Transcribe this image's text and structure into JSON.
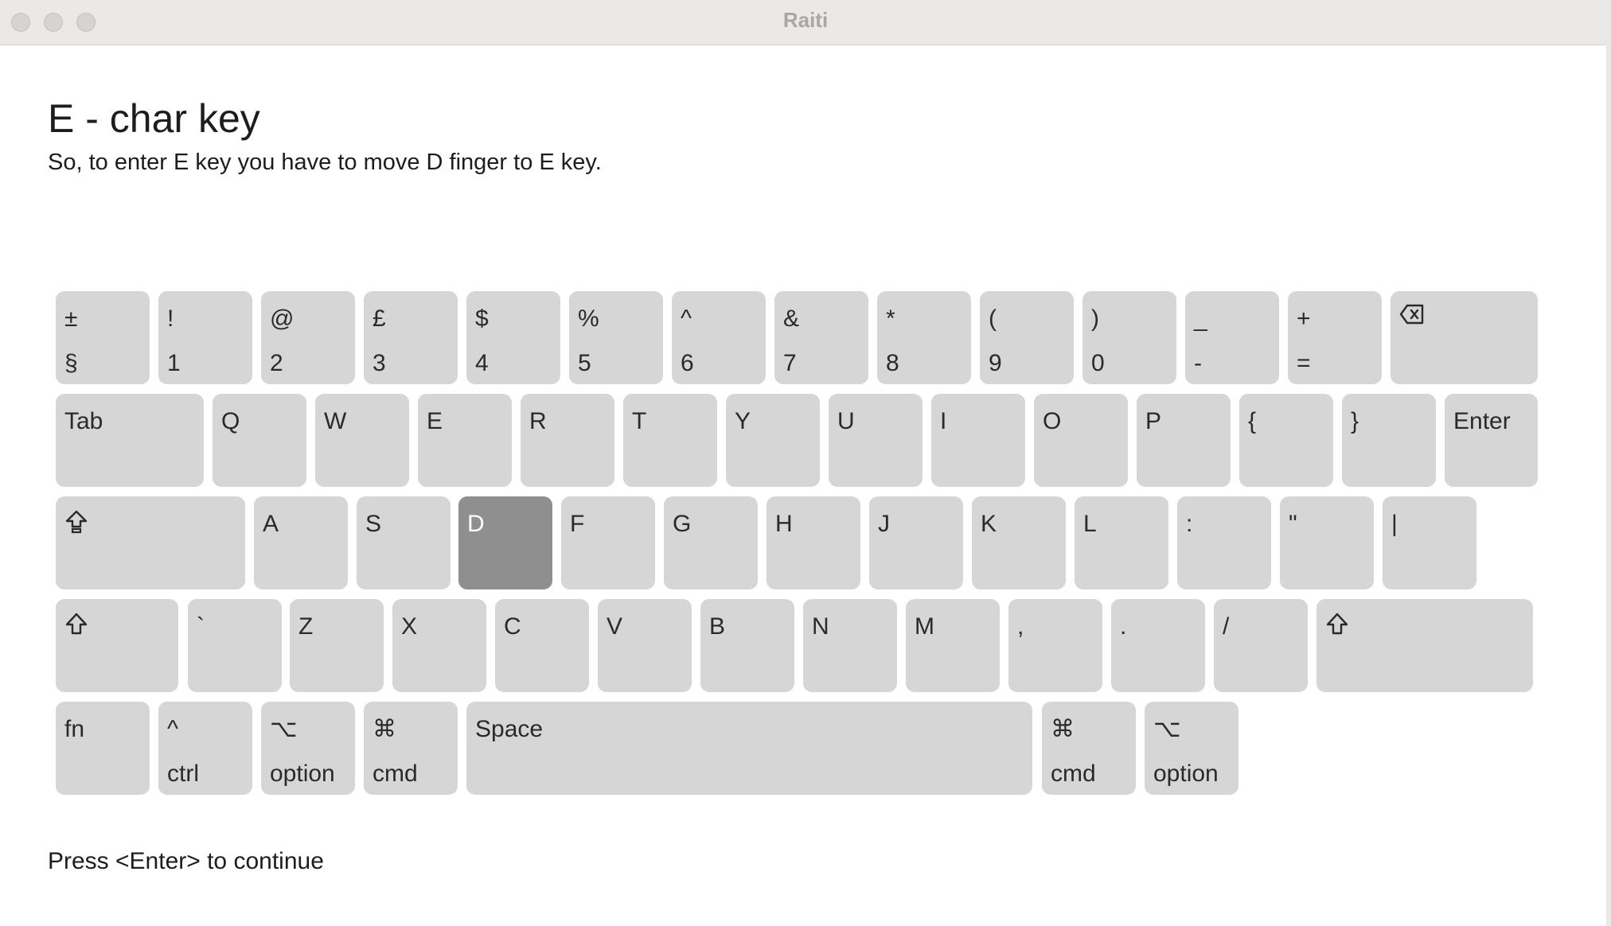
{
  "window": {
    "title": "Raiti"
  },
  "lesson": {
    "title": "E - char key",
    "subtitle": "So, to enter E key you have to move D finger to E key.",
    "footer": "Press <Enter> to continue"
  },
  "keyboard": {
    "highlighted_key": "D",
    "highlight_color": "#8f8f8f",
    "key_color": "#d6d6d6",
    "rows": [
      [
        {
          "top": "±",
          "bottom": "§"
        },
        {
          "top": "!",
          "bottom": "1"
        },
        {
          "top": "@",
          "bottom": "2"
        },
        {
          "top": "£",
          "bottom": "3"
        },
        {
          "top": "$",
          "bottom": "4"
        },
        {
          "top": "%",
          "bottom": "5"
        },
        {
          "top": "^",
          "bottom": "6"
        },
        {
          "top": "&",
          "bottom": "7"
        },
        {
          "top": "*",
          "bottom": "8"
        },
        {
          "top": "(",
          "bottom": "9"
        },
        {
          "top": ")",
          "bottom": "0"
        },
        {
          "top": "_",
          "bottom": "-"
        },
        {
          "top": "+",
          "bottom": "="
        },
        {
          "icon": "backspace-icon"
        }
      ],
      [
        {
          "label": "Tab"
        },
        {
          "label": "Q"
        },
        {
          "label": "W"
        },
        {
          "label": "E"
        },
        {
          "label": "R"
        },
        {
          "label": "T"
        },
        {
          "label": "Y"
        },
        {
          "label": "U"
        },
        {
          "label": "I"
        },
        {
          "label": "O"
        },
        {
          "label": "P"
        },
        {
          "label": "{"
        },
        {
          "label": "}"
        },
        {
          "label": "Enter"
        }
      ],
      [
        {
          "icon": "caps-lock-icon"
        },
        {
          "label": "A"
        },
        {
          "label": "S"
        },
        {
          "label": "D"
        },
        {
          "label": "F"
        },
        {
          "label": "G"
        },
        {
          "label": "H"
        },
        {
          "label": "J"
        },
        {
          "label": "K"
        },
        {
          "label": "L"
        },
        {
          "label": ":"
        },
        {
          "label": "\""
        },
        {
          "label": "|"
        }
      ],
      [
        {
          "icon": "shift-icon"
        },
        {
          "label": "`"
        },
        {
          "label": "Z"
        },
        {
          "label": "X"
        },
        {
          "label": "C"
        },
        {
          "label": "V"
        },
        {
          "label": "B"
        },
        {
          "label": "N"
        },
        {
          "label": "M"
        },
        {
          "label": ","
        },
        {
          "label": "."
        },
        {
          "label": "/"
        },
        {
          "icon": "shift-icon"
        }
      ],
      [
        {
          "label": "fn"
        },
        {
          "top": "^",
          "bottom": "ctrl"
        },
        {
          "top": "⌥",
          "bottom": "option"
        },
        {
          "top": "⌘",
          "bottom": "cmd"
        },
        {
          "label": "Space"
        },
        {
          "top": "⌘",
          "bottom": "cmd"
        },
        {
          "top": "⌥",
          "bottom": "option"
        }
      ]
    ]
  }
}
